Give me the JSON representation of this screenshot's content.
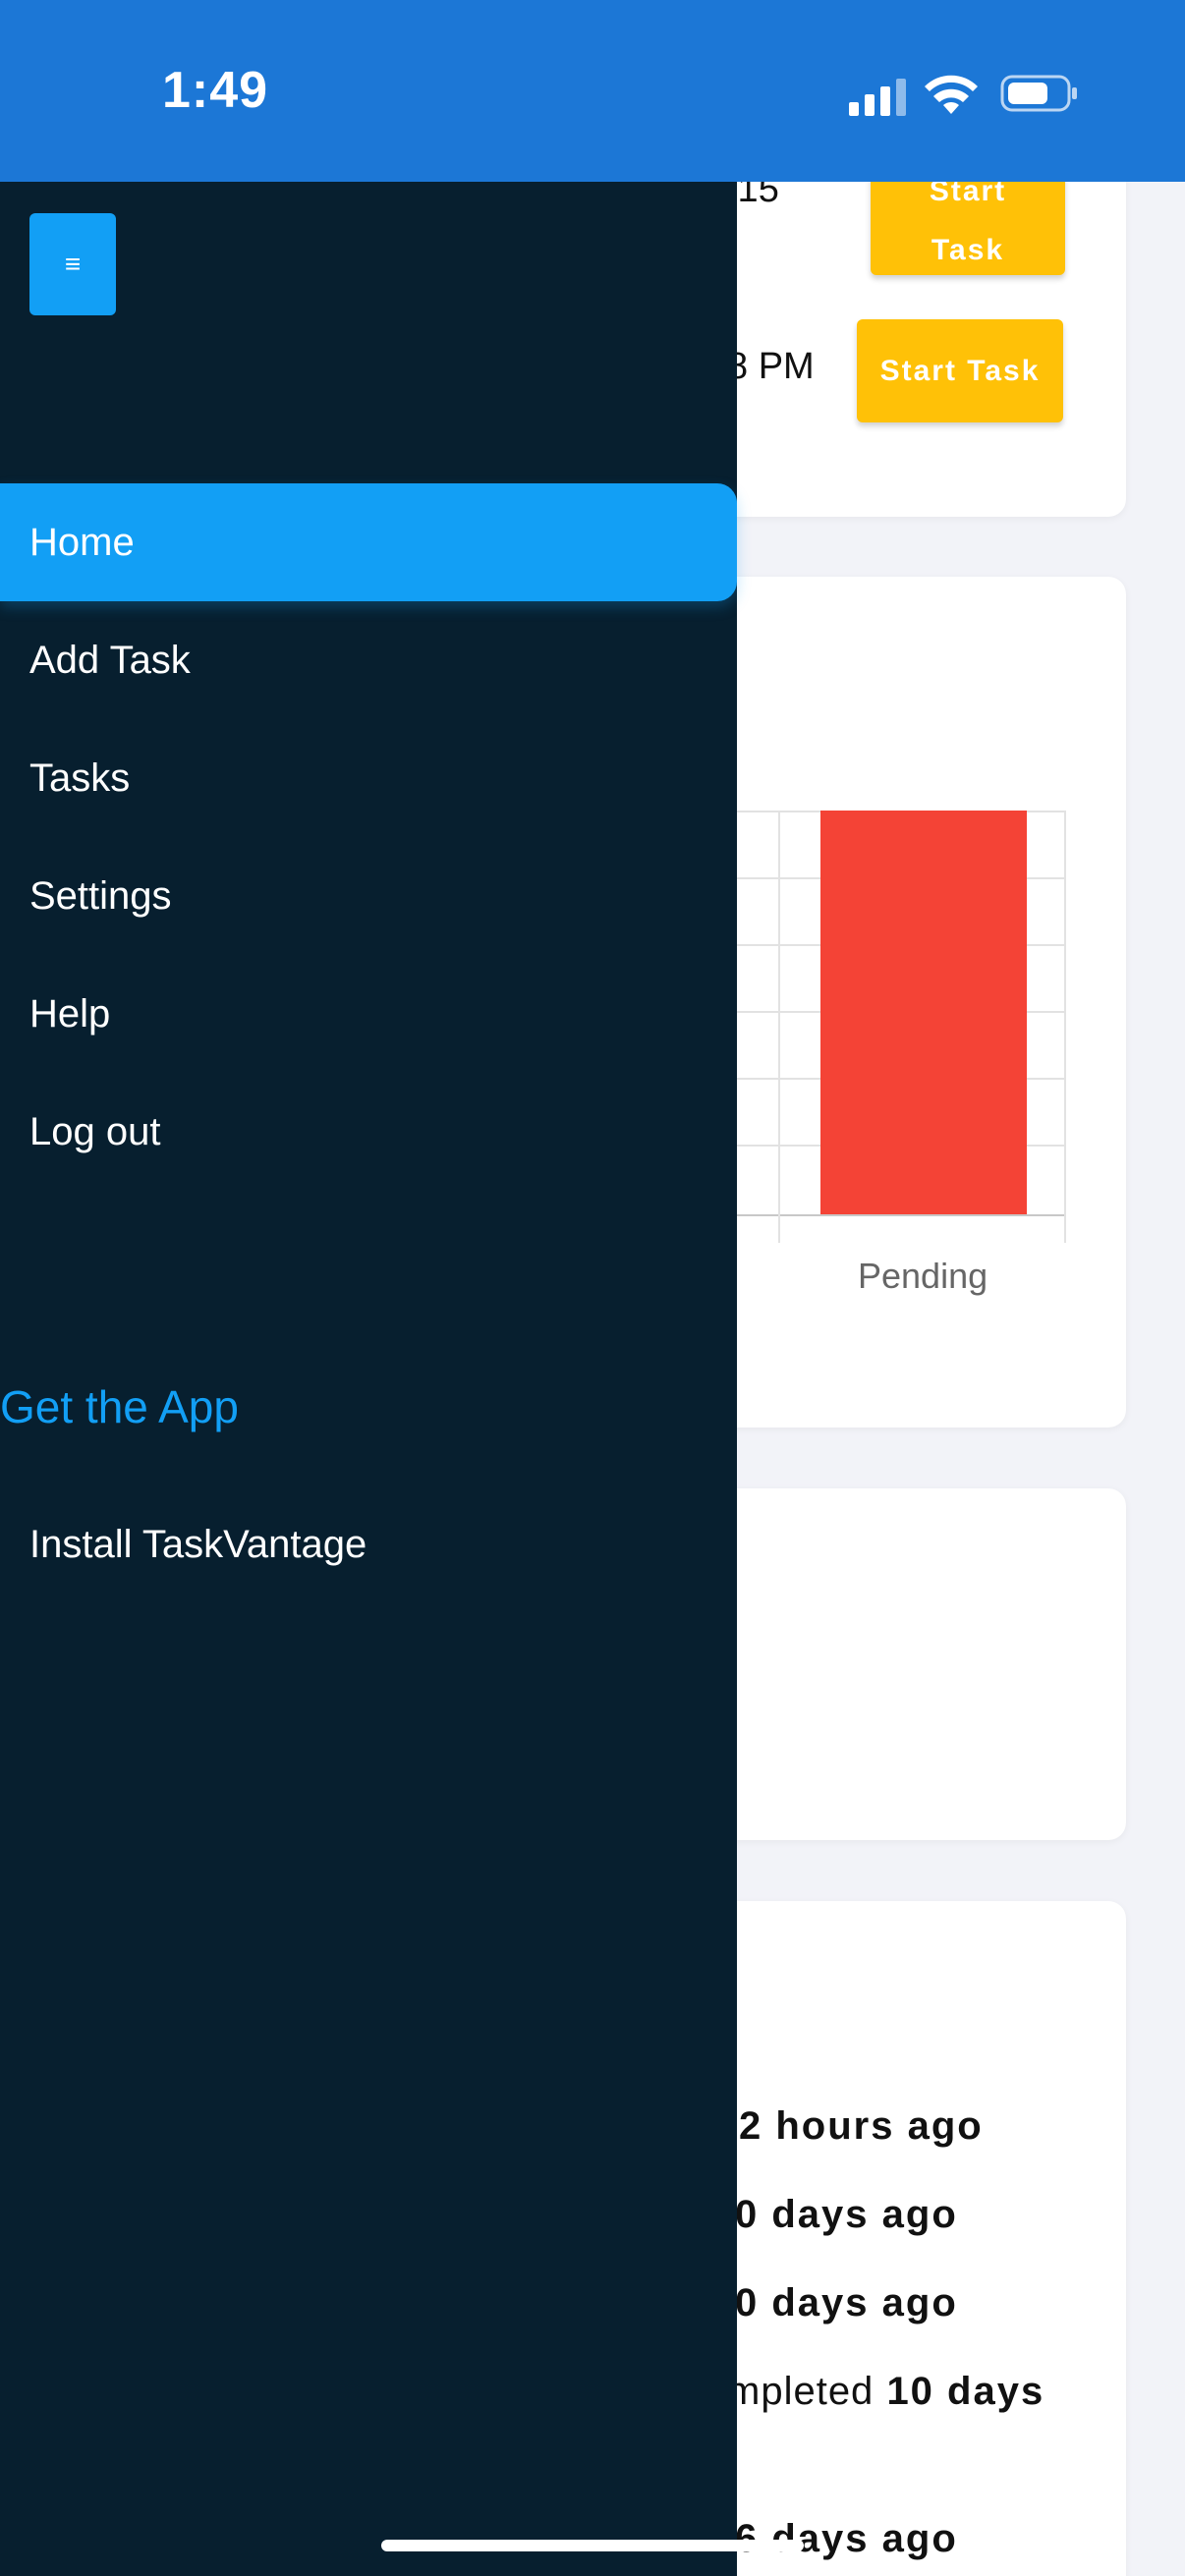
{
  "status_bar": {
    "time": "1:49"
  },
  "background": {
    "task_rows": [
      {
        "time_fragment": ":15",
        "button_label": "Start Task"
      },
      {
        "time_fragment": "8 PM",
        "button_label": "Start Task"
      }
    ],
    "chart_data": {
      "type": "bar",
      "categories": [
        "Pending"
      ],
      "visible_bar_color": "#f44336"
    },
    "activity": [
      {
        "prefix": "",
        "text": "2 hours ago"
      },
      {
        "prefix": "",
        "text": "0 days ago"
      },
      {
        "prefix": "",
        "text": "0 days ago"
      },
      {
        "prefix": "mpleted",
        "text": "10 days"
      },
      {
        "prefix": "",
        "text": "6 days ago"
      }
    ]
  },
  "drawer": {
    "toggle_glyph": "≡",
    "nav_items": [
      {
        "label": "Home",
        "active": true
      },
      {
        "label": "Add Task",
        "active": false
      },
      {
        "label": "Tasks",
        "active": false
      },
      {
        "label": "Settings",
        "active": false
      },
      {
        "label": "Help",
        "active": false
      },
      {
        "label": "Log out",
        "active": false
      }
    ],
    "get_app_heading": "Get the App",
    "install_label": "Install TaskVantage"
  },
  "colors": {
    "status_bar": "#1c77d6",
    "drawer_bg": "#071f2f",
    "accent": "#129ff5",
    "start_button": "#ffc107",
    "pending_bar": "#f44336"
  }
}
